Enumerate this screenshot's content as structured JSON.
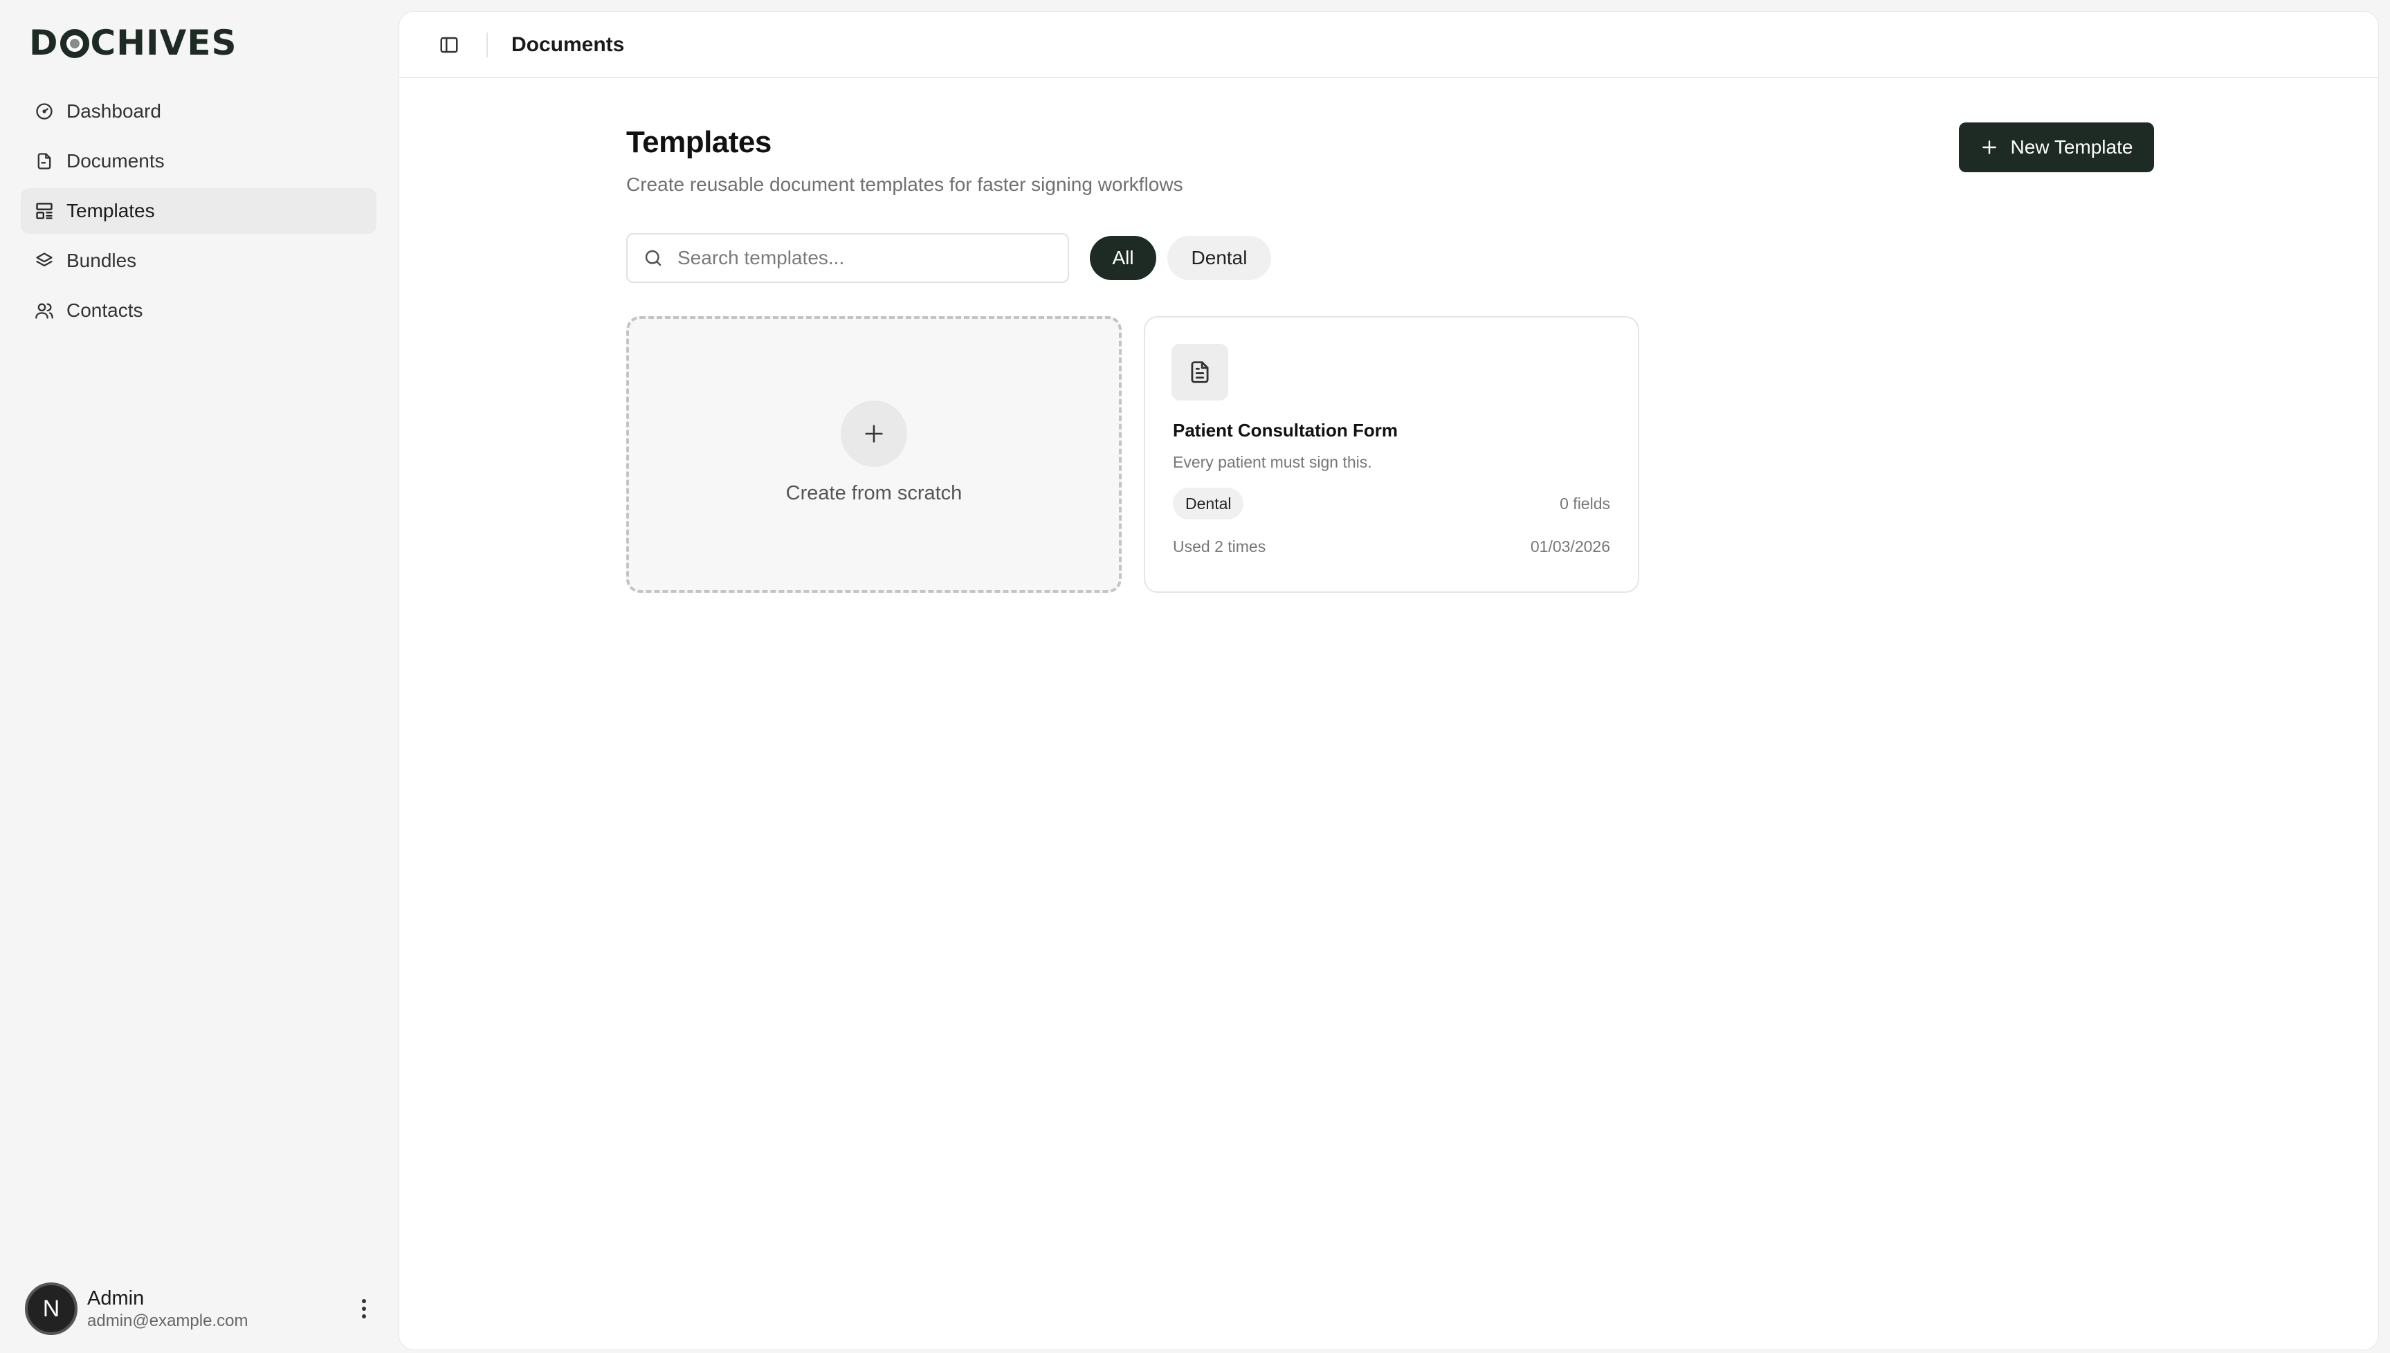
{
  "app": {
    "logo_prefix": "D",
    "logo_suffix": "CHIVES"
  },
  "sidebar": {
    "items": [
      {
        "label": "Dashboard",
        "icon": "gauge-icon",
        "active": false
      },
      {
        "label": "Documents",
        "icon": "file-icon",
        "active": false
      },
      {
        "label": "Templates",
        "icon": "layout-template-icon",
        "active": true
      },
      {
        "label": "Bundles",
        "icon": "layers-icon",
        "active": false
      },
      {
        "label": "Contacts",
        "icon": "users-icon",
        "active": false
      }
    ]
  },
  "user": {
    "initial": "N",
    "name": "Admin",
    "email": "admin@example.com"
  },
  "topbar": {
    "title": "Documents"
  },
  "page": {
    "title": "Templates",
    "subtitle": "Create reusable document templates for faster signing workflows",
    "new_button": "New Template"
  },
  "search": {
    "placeholder": "Search templates...",
    "value": ""
  },
  "filters": {
    "all": "All",
    "dental": "Dental",
    "selected": "All"
  },
  "cards": {
    "scratch_label": "Create from scratch",
    "template": {
      "name": "Patient Consultation Form",
      "description": "Every patient must sign this.",
      "tag": "Dental",
      "fields": "0 fields",
      "used": "Used 2 times",
      "date": "01/03/2026"
    }
  },
  "colors": {
    "accent": "#1e2a24",
    "background": "#f5f5f5",
    "surface": "#ffffff"
  }
}
